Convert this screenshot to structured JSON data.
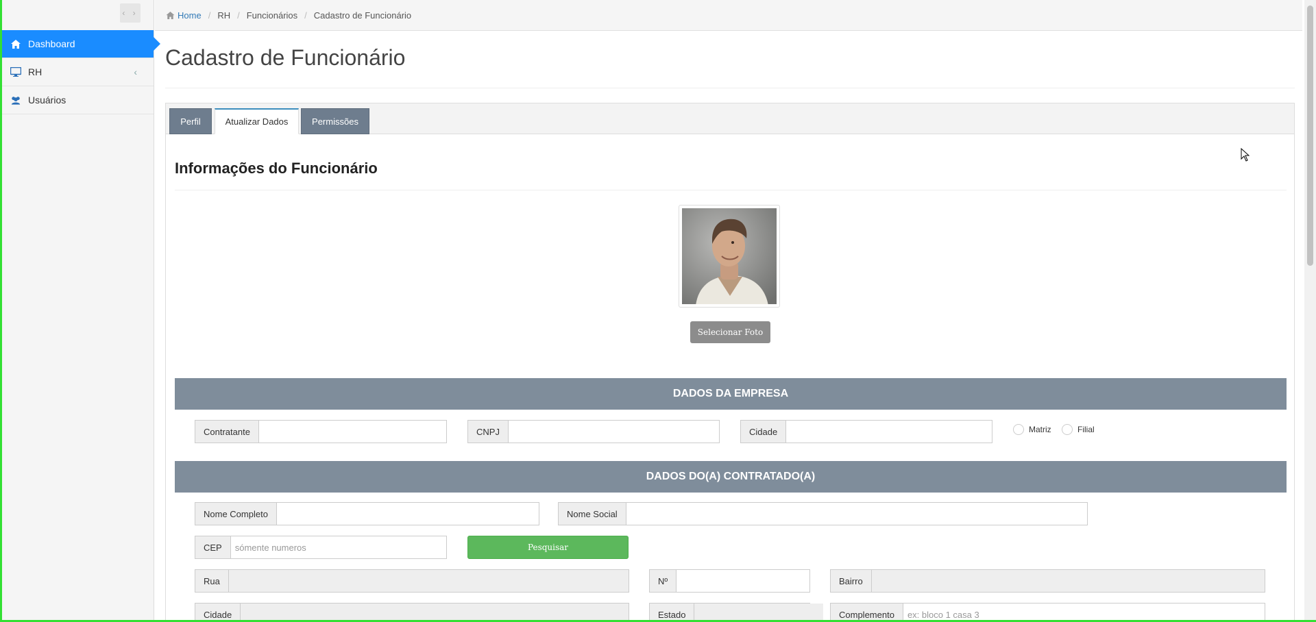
{
  "sidebar": {
    "collapse_label": "‹ ›",
    "items": [
      {
        "label": "Dashboard",
        "icon": "home-icon",
        "active": true
      },
      {
        "label": "RH",
        "icon": "monitor-icon",
        "has_children": true
      },
      {
        "label": "Usuários",
        "icon": "users-icon"
      }
    ]
  },
  "breadcrumb": {
    "items": [
      "Home",
      "RH",
      "Funcionários",
      "Cadastro de Funcionário"
    ]
  },
  "page": {
    "title": "Cadastro de Funcionário"
  },
  "tabs": [
    {
      "label": "Perfil",
      "active": false
    },
    {
      "label": "Atualizar Dados",
      "active": true
    },
    {
      "label": "Permissões",
      "active": false
    }
  ],
  "form": {
    "section_title": "Informações do Funcionário",
    "select_photo_label": "Selecionar Foto",
    "company_band": "DADOS DA EMPRESA",
    "company": {
      "contratante_label": "Contratante",
      "contratante_value": "",
      "cnpj_label": "CNPJ",
      "cnpj_value": "",
      "cidade_label": "Cidade",
      "cidade_value": "",
      "radio_matriz": "Matriz",
      "radio_filial": "Filial"
    },
    "employee_band": "DADOS DO(A) CONTRATADO(A)",
    "employee": {
      "nome_completo_label": "Nome Completo",
      "nome_completo_value": "",
      "nome_social_label": "Nome Social",
      "nome_social_value": "",
      "cep_label": "CEP",
      "cep_placeholder": "sómente numeros",
      "search_label": "Pesquisar",
      "rua_label": "Rua",
      "numero_label": "Nº",
      "bairro_label": "Bairro",
      "cidade_label": "Cidade",
      "estado_label": "Estado",
      "complemento_label": "Complemento",
      "complemento_placeholder": "ex: bloco 1 casa 3"
    }
  },
  "colors": {
    "accent": "#1a8cff",
    "band": "#7f8d9b",
    "tab_dark": "#6e7d8e",
    "success": "#5cb85c"
  }
}
